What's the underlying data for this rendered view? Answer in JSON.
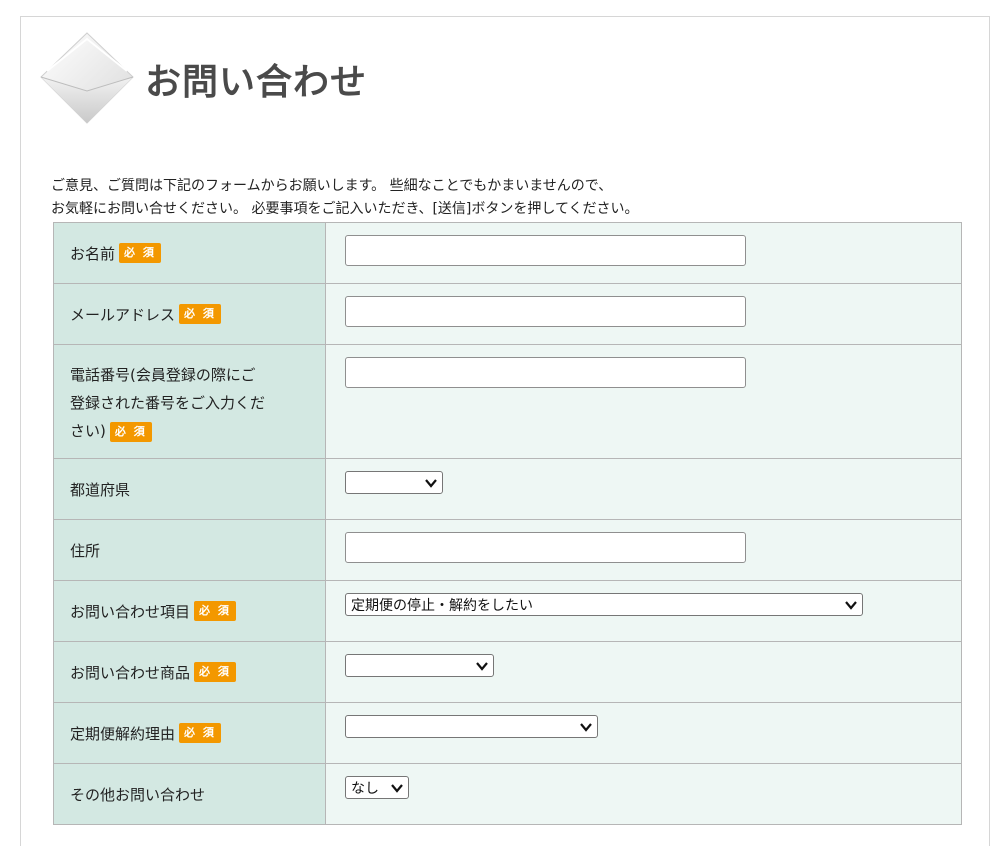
{
  "page": {
    "title": "お問い合わせ"
  },
  "intro": {
    "line1": "ご意見、ご質問は下記のフォームからお願いします。 些細なことでもかまいませんので、",
    "line2": "お気軽にお問い合せください。 必要事項をご記入いただき、[送信]ボタンを押してください。"
  },
  "required_badge": "必 須",
  "fields": {
    "name": {
      "label": "お名前",
      "value": ""
    },
    "email": {
      "label": "メールアドレス",
      "value": ""
    },
    "phone": {
      "label_line1": "電話番号(会員登録の際にご",
      "label_line2": "登録された番号をご入力くだ",
      "label_line3": "さい)",
      "value": ""
    },
    "prefecture": {
      "label": "都道府県",
      "selected": ""
    },
    "address": {
      "label": "住所",
      "value": ""
    },
    "inquiry_item": {
      "label": "お問い合わせ項目",
      "selected": "定期便の停止・解約をしたい"
    },
    "inquiry_product": {
      "label": "お問い合わせ商品",
      "selected": ""
    },
    "cancel_reason": {
      "label": "定期便解約理由",
      "selected": ""
    },
    "other_inquiry": {
      "label": "その他お問い合わせ",
      "selected": "なし"
    }
  },
  "colors": {
    "label_bg": "#d3e8e2",
    "field_bg": "#eef7f4",
    "badge": "#f39800",
    "title": "#4a4a4a"
  }
}
